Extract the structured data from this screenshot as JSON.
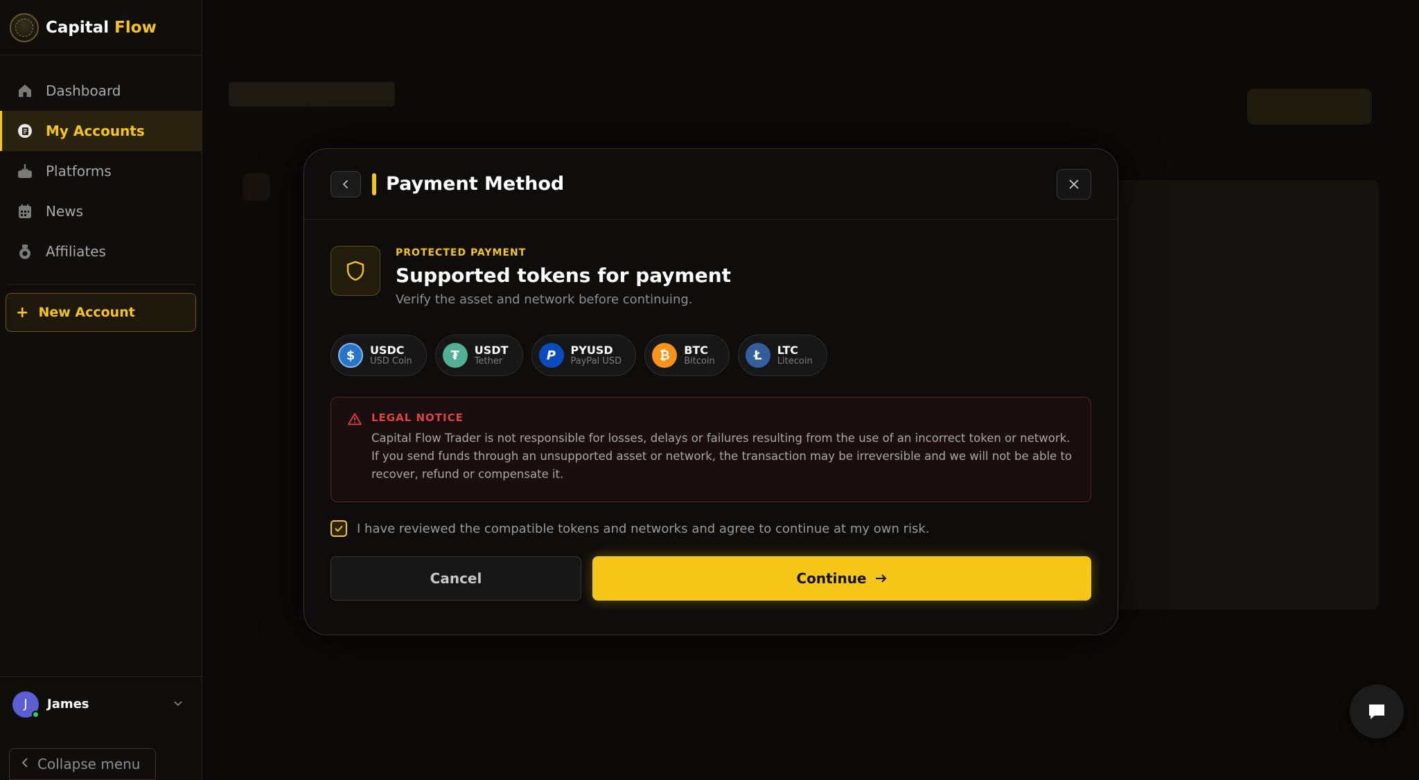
{
  "brand": {
    "name_primary": "Capital",
    "name_accent": "Flow"
  },
  "sidebar": {
    "items": [
      {
        "label": "Dashboard",
        "icon": "home-icon",
        "active": false
      },
      {
        "label": "My Accounts",
        "icon": "accounts-icon",
        "active": true
      },
      {
        "label": "Platforms",
        "icon": "download-icon",
        "active": false
      },
      {
        "label": "News",
        "icon": "calendar-icon",
        "active": false
      },
      {
        "label": "Affiliates",
        "icon": "affiliates-icon",
        "active": false
      }
    ],
    "new_account": {
      "plus": "+",
      "label": "New Account"
    },
    "user": {
      "initial": "J",
      "name": "James"
    },
    "collapse_label": "Collapse menu"
  },
  "modal": {
    "title": "Payment Method",
    "eyebrow": "PROTECTED PAYMENT",
    "headline": "Supported tokens for payment",
    "subline": "Verify the asset and network before continuing.",
    "tokens": [
      {
        "symbol": "USDC",
        "name": "USD Coin",
        "glyph": "$",
        "color": "#2775ca"
      },
      {
        "symbol": "USDT",
        "name": "Tether",
        "glyph": "₮",
        "color": "#50af95"
      },
      {
        "symbol": "PYUSD",
        "name": "PayPal USD",
        "glyph": "P",
        "color": "#0a4bbd"
      },
      {
        "symbol": "BTC",
        "name": "Bitcoin",
        "glyph": "₿",
        "color": "#f7931a"
      },
      {
        "symbol": "LTC",
        "name": "Litecoin",
        "glyph": "Ł",
        "color": "#345d9d"
      }
    ],
    "notice": {
      "title": "LEGAL NOTICE",
      "text": "Capital Flow Trader is not responsible for losses, delays or failures resulting from the use of an incorrect token or network. If you send funds through an unsupported asset or network, the transaction may be irreversible and we will not be able to recover, refund or compensate it."
    },
    "agree": {
      "checked": true,
      "text": "I have reviewed the compatible tokens and networks and agree to continue at my own risk."
    },
    "cancel_label": "Cancel",
    "continue_label": "Continue"
  },
  "colors": {
    "accent": "#f5c518",
    "danger": "#e0443e",
    "online": "#2fcf5f"
  }
}
